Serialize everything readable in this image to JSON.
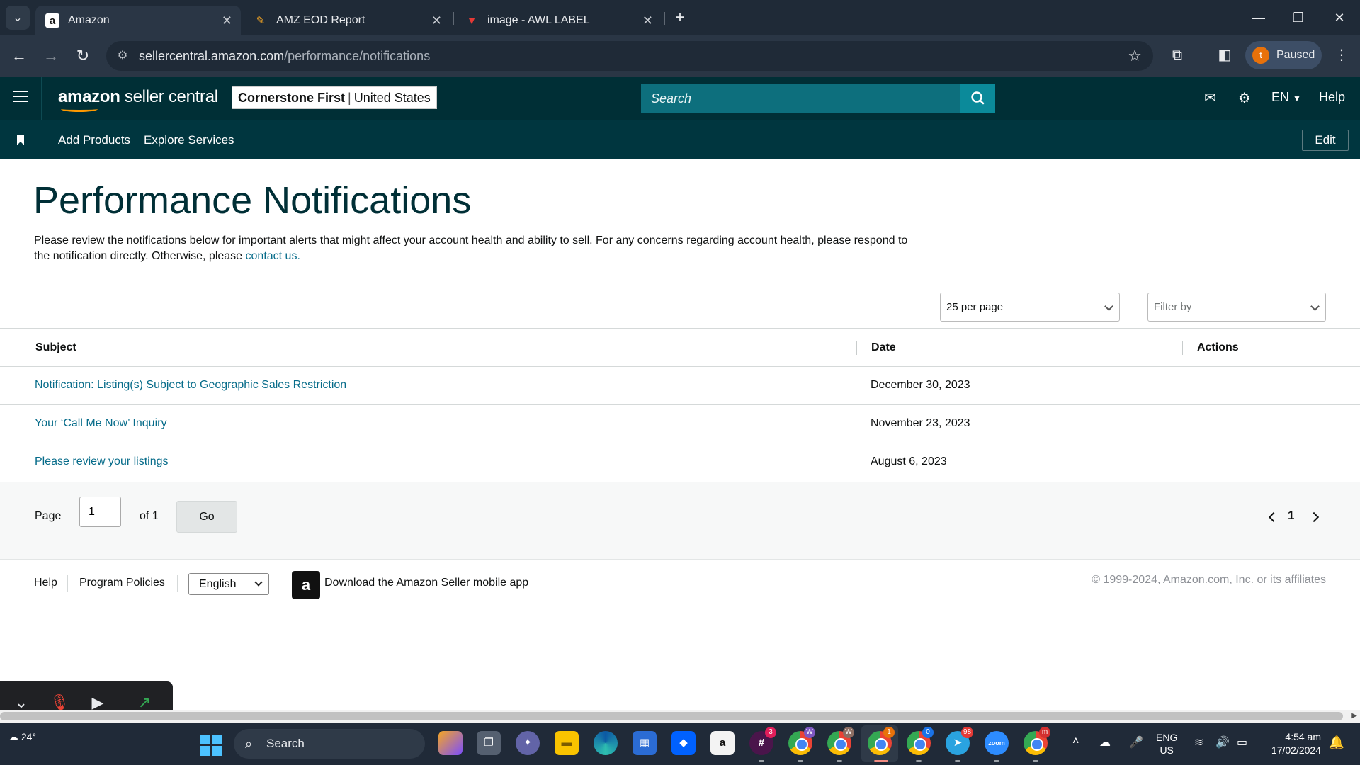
{
  "browser": {
    "tabs": [
      {
        "title": "Amazon",
        "favicon": "a"
      },
      {
        "title": "AMZ EOD Report",
        "favicon": "✎"
      },
      {
        "title": "image - AWL LABEL",
        "favicon": "▼"
      }
    ],
    "url_host": "sellercentral.amazon.com",
    "url_path": "/performance/notifications",
    "profile_initial": "t",
    "profile_status": "Paused"
  },
  "header": {
    "brand_bold": "amazon",
    "brand_rest": " seller central",
    "store_name": "Cornerstone First",
    "store_region": "United States",
    "search_placeholder": "Search",
    "language": "EN",
    "help": "Help"
  },
  "subnav": {
    "links": [
      "Add Products",
      "Explore Services"
    ],
    "edit": "Edit"
  },
  "page": {
    "title": "Performance Notifications",
    "description": "Please review the notifications below for important alerts that might affect your account health and ability to sell. For any concerns regarding account health, please respond to the notification directly. Otherwise, please ",
    "contact_link": "contact us."
  },
  "controls": {
    "per_page": "25 per page",
    "filter_placeholder": "Filter by"
  },
  "table": {
    "columns": [
      "Subject",
      "Date",
      "Actions"
    ],
    "rows": [
      {
        "subject": "Notification: Listing(s) Subject to Geographic Sales Restriction",
        "date": "December 30, 2023"
      },
      {
        "subject": "Your ‘Call Me Now’ Inquiry",
        "date": "November 23, 2023"
      },
      {
        "subject": "Please review your listings",
        "date": "August 6, 2023"
      }
    ]
  },
  "pagination": {
    "page_label": "Page",
    "page_value": "1",
    "of_label": "of 1",
    "go": "Go",
    "current_page": "1"
  },
  "footer": {
    "help": "Help",
    "policies": "Program Policies",
    "language": "English",
    "app_text": "Download the Amazon Seller mobile app",
    "copyright": "© 1999-2024, Amazon.com, Inc. or its affiliates"
  },
  "taskbar": {
    "weather": "24°",
    "search": "Search",
    "lang_line1": "ENG",
    "lang_line2": "US",
    "time": "4:54 am",
    "date": "17/02/2024",
    "badges": [
      "3",
      "W",
      "W",
      "1",
      "0",
      "98",
      "m"
    ]
  }
}
